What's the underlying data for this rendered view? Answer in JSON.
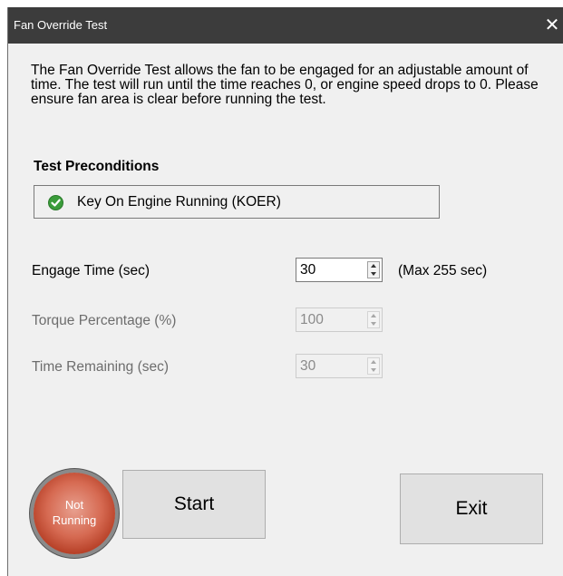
{
  "window": {
    "title": "Fan Override Test",
    "close_glyph": "✕"
  },
  "description": "The Fan Override Test allows the fan to be engaged for an adjustable amount of time. The test will run until the time reaches 0, or engine speed drops to 0. Please ensure fan area is clear before running the test.",
  "preconditions": {
    "heading": "Test Preconditions",
    "items": [
      {
        "label": "Key On Engine Running (KOER)",
        "icon": "check-circle-icon",
        "status": "met",
        "icon_color": "#3a9c3a"
      }
    ]
  },
  "fields": {
    "engage_time": {
      "label": "Engage Time (sec)",
      "value": "30",
      "note": "(Max 255 sec)",
      "enabled": true
    },
    "torque_percentage": {
      "label": "Torque Percentage (%)",
      "value": "100",
      "enabled": false
    },
    "time_remaining": {
      "label": "Time Remaining (sec)",
      "value": "30",
      "enabled": false
    }
  },
  "status": {
    "line1": "Not",
    "line2": "Running",
    "color": "#c9513a"
  },
  "buttons": {
    "start_label": "Start",
    "exit_label": "Exit"
  }
}
